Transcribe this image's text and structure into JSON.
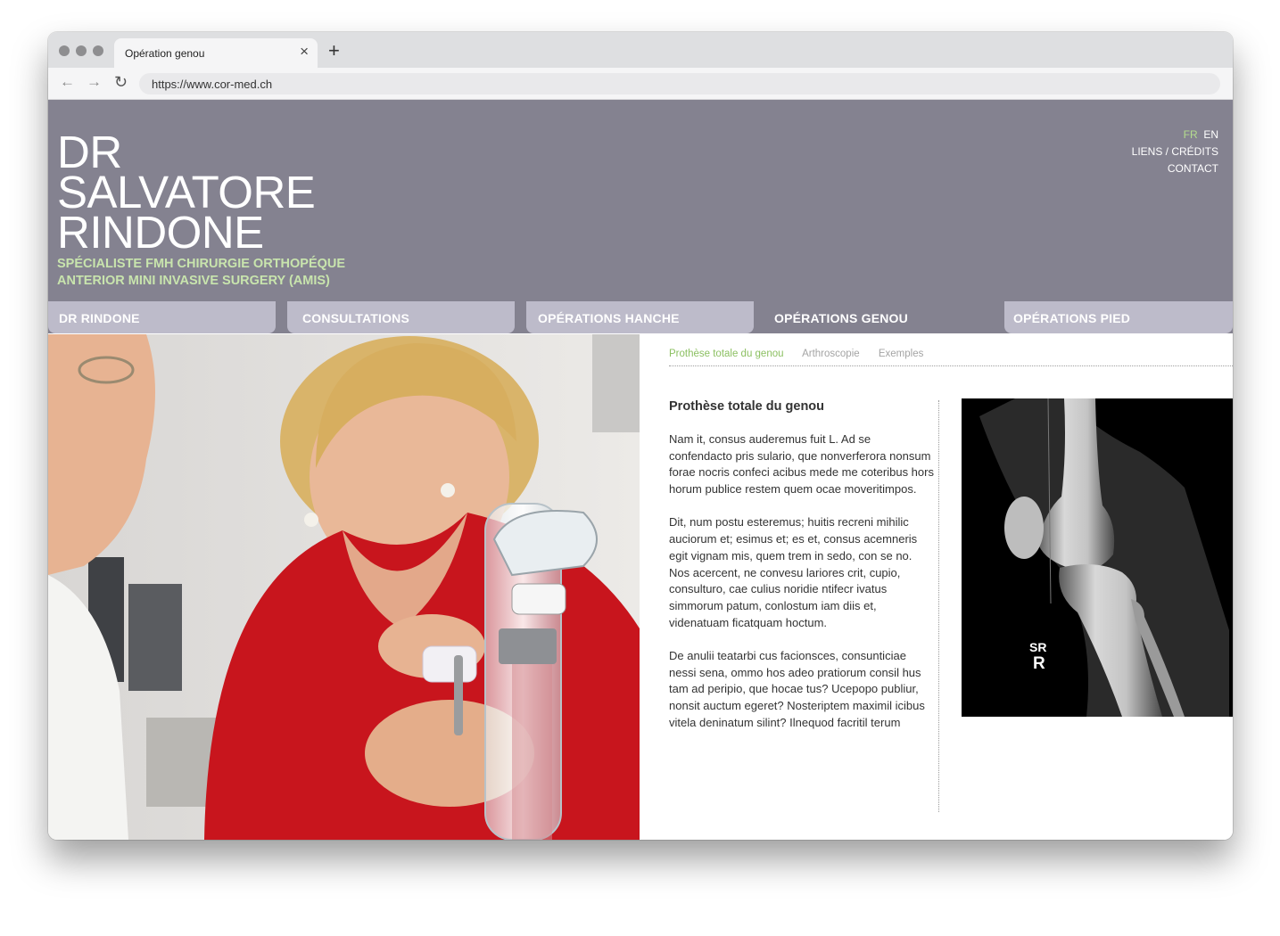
{
  "browser": {
    "tab_title": "Opération genou",
    "close_glyph": "×",
    "new_tab_glyph": "+",
    "back_glyph": "←",
    "forward_glyph": "→",
    "reload_glyph": "↻",
    "url": "https://www.cor-med.ch"
  },
  "header": {
    "name_lines": [
      "DR",
      "SALVATORE",
      "RINDONE"
    ],
    "tagline_lines": [
      "SPÉCIALISTE FMH CHIRURGIE ORTHOPÉQUE",
      "ANTERIOR MINI INVASIVE SURGERY (AMIS)"
    ],
    "languages": {
      "active": "FR",
      "other": "EN"
    },
    "links": [
      "LIENS / CRÉDITS",
      "CONTACT"
    ],
    "background_color": "#848290",
    "accent_color": "#c8e4ad"
  },
  "menu": {
    "items": [
      "DR RINDONE",
      "CONSULTATIONS",
      "OPÉRATIONS HANCHE",
      "OPÉRATIONS GENOU",
      "OPÉRATIONS PIED"
    ],
    "active": "OPÉRATIONS GENOU",
    "inactive_color": "#bdbbca",
    "active_color": "#848290"
  },
  "subnav": {
    "items": [
      "Prothèse totale du genou",
      "Arthroscopie",
      "Exemples"
    ],
    "active": "Prothèse totale du genou",
    "active_color": "#8cc062"
  },
  "article": {
    "title": "Prothèse totale du genou",
    "paragraphs": [
      "Nam it, consus auderemus fuit L. Ad se confendacto pris sulario, que nonverferora nonsum forae nocris confeci acibus mede me coteribus hors horum publice restem quem ocae moveritimpos.",
      "Dit, num postu esteremus; huitis recreni mihilic auciorum et; esimus et; es et, consus acemneris egit vignam mis, quem trem in sedo, con se no. Nos acercent, ne convesu lariores crit, cupio, consulturo, cae culius noridie ntifecr ivatus simmorum patum, conlostum iam diis et, videnatuam ficatquam hoctum.",
      "De anulii teatarbi cus facionsces, consunticiae nessi sena, ommo hos adeo pratiorum consil hus tam ad peripio, que hocae tus? Ucepopo publiur, nonsit auctum egeret? Nosteriptem maximil icibus vitela deninatum silint? Ilnequod facritil terum"
    ]
  },
  "xray": {
    "marker_lines": [
      "SR",
      "R"
    ]
  },
  "icons": {
    "window_dots": "traffic-light-dots",
    "photo": "doctor-patient-knee-model-photo",
    "xray": "knee-xray-image"
  }
}
